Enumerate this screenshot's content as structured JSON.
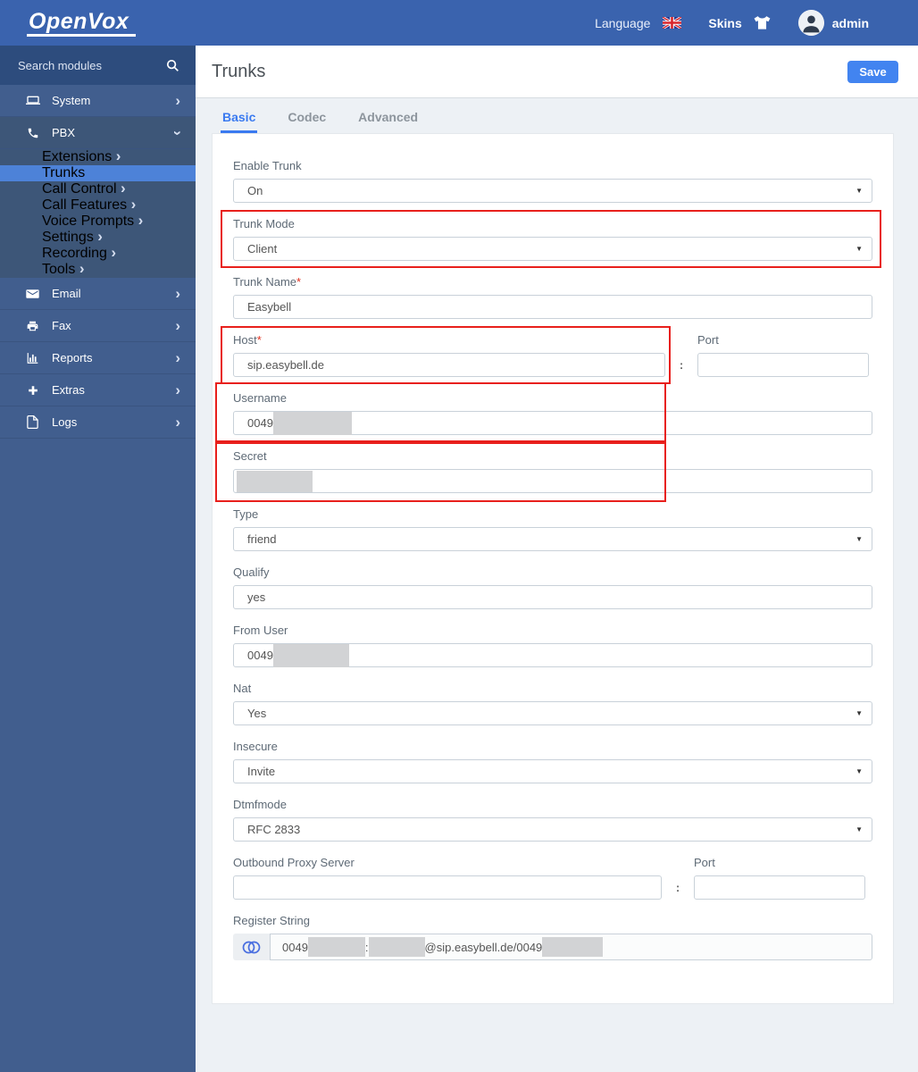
{
  "header": {
    "logo": "OpenVox",
    "language_label": "Language",
    "skins_label": "Skins",
    "user_name": "admin"
  },
  "sidebar": {
    "search_placeholder": "Search modules",
    "top_items": [
      {
        "label": "System"
      },
      {
        "label": "PBX"
      }
    ],
    "pbx_submenu": [
      {
        "label": "Extensions"
      },
      {
        "label": "Trunks"
      },
      {
        "label": "Call Control"
      },
      {
        "label": "Call Features"
      },
      {
        "label": "Voice Prompts"
      },
      {
        "label": "Settings"
      },
      {
        "label": "Recording"
      },
      {
        "label": "Tools"
      }
    ],
    "bottom_items": [
      {
        "label": "Email"
      },
      {
        "label": "Fax"
      },
      {
        "label": "Reports"
      },
      {
        "label": "Extras"
      },
      {
        "label": "Logs"
      }
    ],
    "active_item": "Trunks"
  },
  "page": {
    "title": "Trunks",
    "save_label": "Save",
    "tabs": {
      "basic": "Basic",
      "codec": "Codec",
      "advanced": "Advanced"
    },
    "active_tab": "Basic"
  },
  "form": {
    "colon": ":",
    "enable_trunk": {
      "label": "Enable Trunk",
      "value": "On"
    },
    "trunk_mode": {
      "label": "Trunk Mode",
      "value": "Client"
    },
    "trunk_name": {
      "label": "Trunk Name",
      "required_mark": "*",
      "value": "Easybell"
    },
    "host": {
      "label": "Host",
      "required_mark": "*",
      "value": "sip.easybell.de"
    },
    "host_port": {
      "label": "Port",
      "value": ""
    },
    "username": {
      "label": "Username",
      "value": "0049",
      "redacted": true
    },
    "secret": {
      "label": "Secret",
      "value": "",
      "redacted": true
    },
    "type": {
      "label": "Type",
      "value": "friend"
    },
    "qualify": {
      "label": "Qualify",
      "value": "yes"
    },
    "from_user": {
      "label": "From User",
      "value": "0049",
      "redacted": true
    },
    "nat": {
      "label": "Nat",
      "value": "Yes"
    },
    "insecure": {
      "label": "Insecure",
      "value": "Invite"
    },
    "dtmfmode": {
      "label": "Dtmfmode",
      "value": "RFC 2833"
    },
    "outbound_proxy": {
      "label": "Outbound Proxy Server",
      "value": ""
    },
    "outbound_port": {
      "label": "Port",
      "value": ""
    },
    "register_string": {
      "label": "Register String",
      "part1": "0049",
      "part2": ":",
      "part3": "@sip.easybell.de/0049",
      "redacted": true
    }
  },
  "icons": {
    "select_arrow": "▼",
    "chevron": "›"
  },
  "colors": {
    "header_blue": "#3a63ae",
    "sidebar_blue": "#415e8e",
    "sidebar_dark": "#3d5678",
    "sidebar_active": "#4d82d8",
    "accent_blue": "#4284f0",
    "highlight_red": "#e8201c",
    "redaction_gray": "#d2d3d5"
  }
}
